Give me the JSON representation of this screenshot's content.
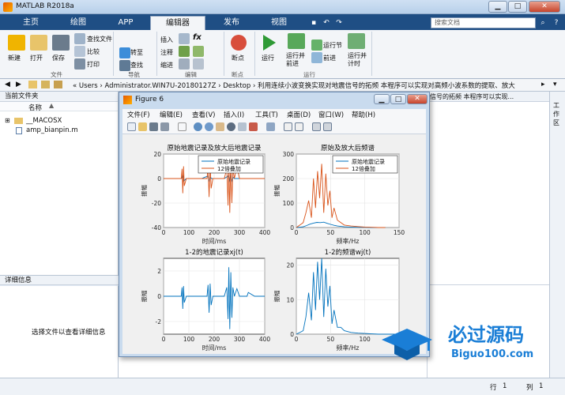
{
  "window": {
    "title": "MATLAB R2018a"
  },
  "ribbon_tabs": [
    "主页",
    "绘图",
    "APP",
    "编辑器",
    "发布",
    "视图"
  ],
  "search_placeholder": "搜索文档",
  "ribbon": {
    "file": {
      "new": "新建",
      "open": "打开",
      "save": "保存",
      "find_file": "查找文件",
      "compare": "比较",
      "print": "打印",
      "group": "文件"
    },
    "nav": {
      "goto": "转至",
      "find": "查找",
      "group": "导航"
    },
    "edit": {
      "insert": "插入",
      "comment": "注释",
      "indent": "缩进",
      "fx": "fx",
      "group": "编辑"
    },
    "breakpoints": {
      "label": "断点",
      "group": "断点"
    },
    "run": {
      "run": "运行",
      "run_advance": "运行并前进",
      "run_section": "运行节",
      "advance": "前进",
      "run_time": "运行并计时",
      "group": "运行"
    }
  },
  "address": {
    "path": "« Users › Administrator.WIN7U-20180127Z › Desktop › 利用连续小波变换实现对地震信号的拓频 本程序可以实现对高频小波系数的提取、放大"
  },
  "current_folder": {
    "title": "当前文件夹",
    "name_col": "名称",
    "files": [
      "__MACOSX",
      "amp_bianpin.m"
    ]
  },
  "detail": {
    "title": "详细信息",
    "hint": "选择文件以查看详细信息"
  },
  "workspace_title": "信号的拓频 本程序可以实现...",
  "status": {
    "row_label": "行",
    "row": "1",
    "col_label": "列",
    "col": "1"
  },
  "figure": {
    "title": "Figure 6",
    "menu": [
      "文件(F)",
      "编辑(E)",
      "查看(V)",
      "插入(I)",
      "工具(T)",
      "桌面(D)",
      "窗口(W)",
      "帮助(H)"
    ]
  },
  "watermark": {
    "main": "必过源码",
    "sub": "Biguo100.com"
  },
  "chart_data": [
    {
      "type": "line",
      "title": "原始地震记录及放大后地震记录",
      "xlabel": "时间/ms",
      "ylabel": "振幅",
      "xlim": [
        0,
        400
      ],
      "ylim": [
        -40,
        20
      ],
      "xticks": [
        0,
        100,
        200,
        300,
        400
      ],
      "yticks": [
        -40,
        -20,
        0,
        20
      ],
      "legend": "top-right",
      "series": [
        {
          "name": "原始地震记录",
          "color": "#0072bd",
          "x": [
            0,
            40,
            70,
            75,
            80,
            90,
            110,
            150,
            175,
            180,
            185,
            190,
            240,
            255,
            260,
            265,
            270,
            275,
            280,
            290,
            320,
            360,
            400
          ],
          "y": [
            0,
            0,
            0,
            2,
            -2,
            0,
            0,
            0,
            2,
            -2,
            1,
            0,
            0,
            2,
            -3,
            3,
            -2,
            1,
            0,
            0,
            0,
            0,
            0
          ]
        },
        {
          "name": "12倍叠加",
          "color": "#d95319",
          "x": [
            0,
            40,
            70,
            73,
            76,
            79,
            82,
            90,
            110,
            150,
            172,
            176,
            180,
            184,
            188,
            195,
            240,
            250,
            255,
            258,
            262,
            266,
            270,
            274,
            280,
            290,
            300,
            330,
            335,
            360,
            400
          ],
          "y": [
            0,
            0,
            0,
            8,
            -12,
            10,
            -6,
            0,
            0,
            0,
            0,
            10,
            -15,
            12,
            -8,
            0,
            0,
            8,
            -22,
            15,
            -28,
            18,
            -20,
            8,
            0,
            10,
            0,
            0,
            0,
            0,
            0
          ]
        }
      ]
    },
    {
      "type": "line",
      "title": "原始及放大后频谱",
      "xlabel": "频率/Hz",
      "ylabel": "振幅",
      "xlim": [
        0,
        150
      ],
      "ylim": [
        0,
        300
      ],
      "xticks": [
        0,
        50,
        100,
        150
      ],
      "yticks": [
        0,
        100,
        200,
        300
      ],
      "legend": "top-right",
      "series": [
        {
          "name": "原始地震记录",
          "color": "#0072bd",
          "x": [
            0,
            10,
            15,
            20,
            25,
            30,
            35,
            40,
            45,
            50,
            55,
            60,
            70,
            80,
            90,
            100,
            110,
            120,
            130
          ],
          "y": [
            0,
            3,
            8,
            14,
            18,
            21,
            20,
            22,
            17,
            13,
            9,
            6,
            3,
            2,
            1,
            1,
            0,
            0,
            0
          ]
        },
        {
          "name": "12倍叠加",
          "color": "#d95319",
          "x": [
            0,
            10,
            14,
            18,
            22,
            25,
            28,
            31,
            34,
            37,
            40,
            43,
            46,
            49,
            52,
            55,
            60,
            65,
            70,
            80,
            90,
            100,
            110,
            120,
            130
          ],
          "y": [
            0,
            20,
            60,
            110,
            40,
            200,
            80,
            230,
            120,
            260,
            60,
            220,
            90,
            150,
            40,
            80,
            30,
            20,
            10,
            6,
            4,
            2,
            1,
            0,
            0
          ]
        }
      ]
    },
    {
      "type": "line",
      "title": "1-2的地震记录xj(t)",
      "xlabel": "时间/ms",
      "ylabel": "振幅",
      "xlim": [
        0,
        400
      ],
      "ylim": [
        -3,
        3
      ],
      "xticks": [
        0,
        100,
        200,
        300,
        400
      ],
      "yticks": [
        -2,
        0,
        2
      ],
      "series": [
        {
          "color": "#0072bd",
          "x": [
            0,
            40,
            70,
            73,
            76,
            79,
            82,
            90,
            110,
            150,
            172,
            176,
            180,
            184,
            188,
            195,
            240,
            250,
            255,
            258,
            262,
            266,
            270,
            274,
            280,
            290,
            300,
            330,
            335,
            360,
            400
          ],
          "y": [
            0,
            0,
            0,
            0.7,
            -1.0,
            0.8,
            -0.5,
            0,
            0,
            0,
            0,
            0.9,
            -1.3,
            1.0,
            -0.7,
            0,
            0,
            0.7,
            -1.8,
            2.3,
            -2.6,
            1.9,
            -1.7,
            0.7,
            0,
            0.6,
            0,
            0,
            0.3,
            0,
            0
          ]
        }
      ]
    },
    {
      "type": "line",
      "title": "1-2的频谱wj(t)",
      "xlabel": "频率/Hz",
      "ylabel": "振幅",
      "xlim": [
        0,
        150
      ],
      "ylim": [
        0,
        22
      ],
      "xticks": [
        0,
        50,
        100,
        150
      ],
      "yticks": [
        0,
        10,
        20
      ],
      "series": [
        {
          "color": "#0072bd",
          "x": [
            0,
            10,
            14,
            18,
            22,
            25,
            28,
            31,
            34,
            37,
            40,
            43,
            46,
            49,
            52,
            55,
            60,
            65,
            70,
            80,
            90,
            100,
            110,
            120,
            130,
            150
          ],
          "y": [
            0,
            1,
            5,
            12,
            4,
            18,
            7,
            21,
            10,
            22,
            5,
            19,
            8,
            14,
            3,
            7,
            2,
            2,
            1,
            0.5,
            0.3,
            0.2,
            0.1,
            0,
            0,
            0
          ]
        }
      ]
    }
  ]
}
